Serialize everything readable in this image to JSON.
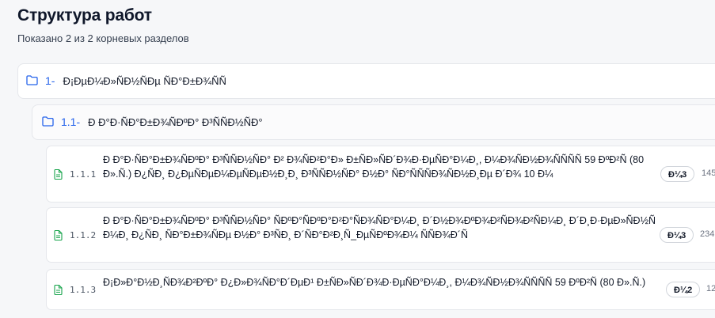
{
  "page": {
    "title": "Структура работ",
    "subtitle": "Показано 2 из 2 корневых разделов"
  },
  "sections": [
    {
      "number": "1-",
      "name": "Ð¡ÐµÐ¼Ð»ÑÐ½ÑÐµ ÑÐ°Ð±Ð¾ÑÑ",
      "icon": "folder-icon",
      "children": [
        {
          "number": "1.1-",
          "name": "Ð Ð°Ð·ÑÐ°Ð±Ð¾ÑÐºÐ° Ð³ÑÑÐ½ÑÐ°",
          "icon": "folder-icon",
          "items": [
            {
              "code": "1.1.1",
              "name": "Ð Ð°Ð·ÑÐ°Ð±Ð¾ÑÐºÐ° Ð³ÑÑÐ½ÑÐ° Ð² Ð¾ÑÐ²Ð°Ð» Ð±ÑÐ»ÑÐ´Ð¾Ð·ÐµÑÐ°Ð¼Ð¸, Ð¼Ð¾ÑÐ½Ð¾ÑÑÑÑ 59 ÐºÐ²Ñ (80 Ð».Ñ.) Ð¿ÑÐ¸ Ð¿ÐµÑÐµÐ¼ÐµÑÐµÐ½Ð¸Ð¸ Ð³ÑÑÐ½ÑÐ° Ð½Ð° ÑÐ°ÑÑÑÐ¾ÑÐ½Ð¸Ðµ Ð´Ð¾ 10 Ð¼",
              "unit": "Ð¼3",
              "qty": "145",
              "icon": "document-icon"
            },
            {
              "code": "1.1.2",
              "name": "Ð Ð°Ð·ÑÐ°Ð±Ð¾ÑÐºÐ° Ð³ÑÑÐ½ÑÐ° ÑÐºÐ°ÑÐºÐ°Ð²Ð°ÑÐ¾ÑÐ°Ð¼Ð¸ Ð´Ð½Ð¾ÐºÐ¾Ð²ÑÐ¾Ð²ÑÐ¼Ð¸ Ð´Ð¸Ð·ÐµÐ»ÑÐ½ÑÐ¼Ð¸ Ð¿ÑÐ¸ ÑÐ°Ð±Ð¾ÑÐµ Ð½Ð° Ð³ÑÐ¸ Ð´ÑÐ°Ð²Ð¸Ñ_ÐµÑÐºÐ¾Ð¼ ÑÑÐ¾Ð´Ñ",
              "unit": "Ð¼3",
              "qty": "234",
              "icon": "document-icon"
            },
            {
              "code": "1.1.3",
              "name": "Ð¡Ð»Ð°Ð½Ð¸ÑÐ¾Ð²ÐºÐ° Ð¿Ð»Ð¾ÑÐ°Ð´ÐµÐ¹ Ð±ÑÐ»ÑÐ´Ð¾Ð·ÐµÑÐ°Ð¼Ð¸, Ð¼Ð¾ÑÐ½Ð¾ÑÑÑÑ 59 ÐºÐ²Ñ (80 Ð».Ñ.)",
              "unit": "Ð¼2",
              "qty": "12",
              "icon": "document-icon"
            }
          ]
        }
      ]
    }
  ],
  "colors": {
    "accent": "#2563eb",
    "document_icon": "#16a34a",
    "background": "#f6f7f9"
  }
}
